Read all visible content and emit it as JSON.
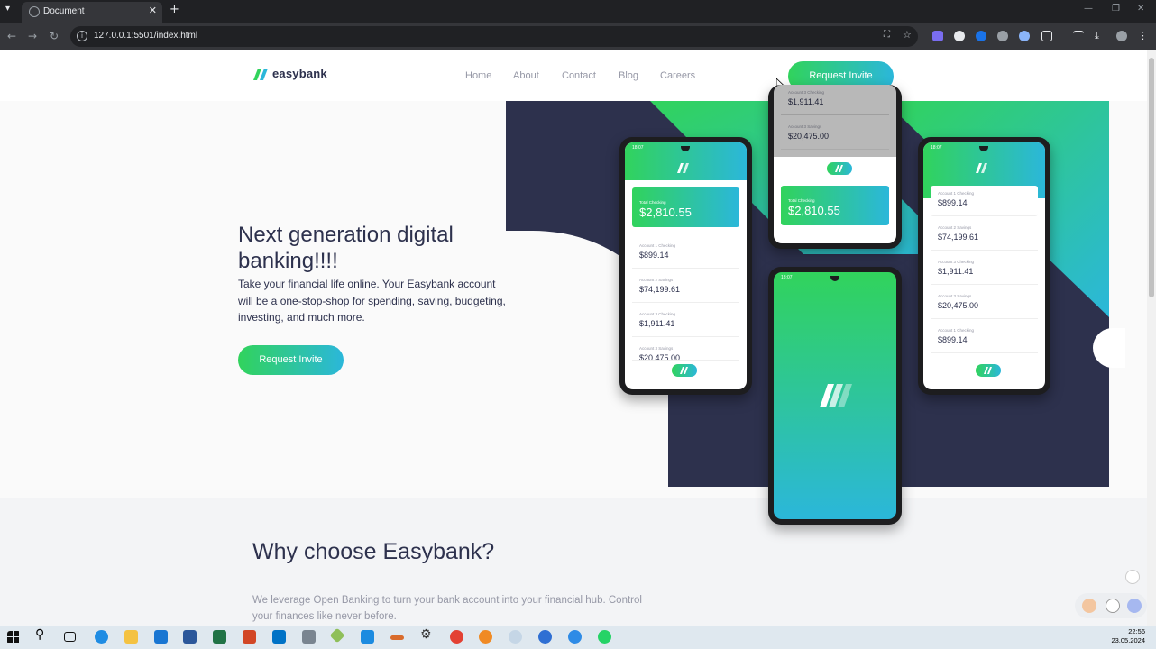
{
  "browser": {
    "tab_title": "Document",
    "url": "127.0.0.1:5501/index.html"
  },
  "header": {
    "logo_text": "easybank",
    "nav": [
      "Home",
      "About",
      "Contact",
      "Blog",
      "Careers"
    ],
    "cta_label": "Request Invite"
  },
  "hero": {
    "headline": "Next generation digital banking!!!!",
    "subtext": "Take your financial life online. Your Easybank account will be a one-stop-shop for spending, saving, budgeting, investing, and much more.",
    "cta_label": "Request Invite"
  },
  "phones": {
    "left": {
      "status_time": "18:07",
      "total_label": "Total Checking",
      "total_amount": "$2,810.55",
      "accounts": [
        {
          "label": "Account 1 Checking",
          "amount": "$899.14"
        },
        {
          "label": "Account 2 Savings",
          "amount": "$74,199.61"
        },
        {
          "label": "Account 3 Checking",
          "amount": "$1,911.41"
        },
        {
          "label": "Account 3 Savings",
          "amount": "$20,475.00"
        }
      ]
    },
    "top": {
      "accounts": [
        {
          "label": "Account 3 Checking",
          "amount": "$1,911.41"
        },
        {
          "label": "Account 3 Savings",
          "amount": "$20,475.00"
        }
      ],
      "total_label": "Total Checking",
      "total_amount": "$2,810.55"
    },
    "right": {
      "status_time": "18:07",
      "accounts": [
        {
          "label": "Account 1 Checking",
          "amount": "$899.14"
        },
        {
          "label": "Account 2 Savings",
          "amount": "$74,199.61"
        },
        {
          "label": "Account 3 Checking",
          "amount": "$1,911.41"
        },
        {
          "label": "Account 3 Savings",
          "amount": "$20,475.00"
        },
        {
          "label": "Account 1 Checking",
          "amount": "$899.14"
        }
      ]
    },
    "bottom": {
      "status_time": "18:07"
    }
  },
  "why": {
    "title": "Why choose Easybank?",
    "text": "We leverage Open Banking to turn your bank account into your financial hub. Control your finances like never before."
  },
  "taskbar": {
    "time": "22:56",
    "date": "23.05.2024"
  },
  "colors": {
    "dark_blue": "#2d314d",
    "green": "#31d35c",
    "cyan": "#2bb7da",
    "grey_text": "#9698a6"
  }
}
